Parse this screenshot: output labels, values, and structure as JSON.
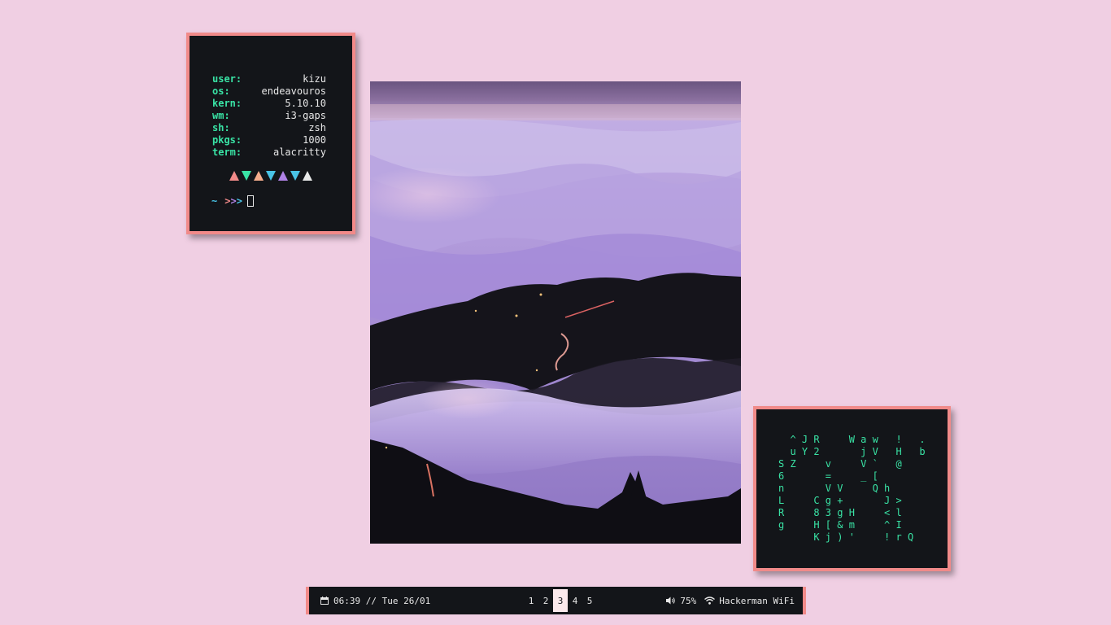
{
  "fetch": {
    "rows": [
      {
        "key": "user:",
        "value": "kizu"
      },
      {
        "key": "os:",
        "value": "endeavouros"
      },
      {
        "key": "kern:",
        "value": "5.10.10"
      },
      {
        "key": "wm:",
        "value": "i3-gaps"
      },
      {
        "key": "sh:",
        "value": "zsh"
      },
      {
        "key": "pkgs:",
        "value": "1000"
      },
      {
        "key": "term:",
        "value": "alacritty"
      }
    ],
    "triangle_colors": [
      "#f18a89",
      "#39e3a5",
      "#f4ad8c",
      "#49c3e6",
      "#b082e6",
      "#49c3e6",
      "#e8e8e8"
    ],
    "prompt": {
      "tilde": "~",
      "a1": ">",
      "a2": ">",
      "a3": ">"
    }
  },
  "matrix": {
    "lines": [
      "  ^ J R     W a w   !   .",
      "  u Y 2       j V   H   b",
      "S Z     v     V `   @",
      "6       =     _ [",
      "n       V V     Q h",
      "L     C g +       J >",
      "R     8 3 g H     < l",
      "g     H [ & m     ^ I",
      "      K j ) '     ! r Q"
    ]
  },
  "bar": {
    "clock_icon": "calendar-icon",
    "clock": "06:39 // Tue 26/01",
    "workspaces": [
      "1",
      "2",
      "3",
      "4",
      "5"
    ],
    "active_workspace": "3",
    "volume_icon": "speaker-icon",
    "volume": "75%",
    "wifi_icon": "wifi-icon",
    "network": "Hackerman WiFi"
  },
  "colors": {
    "background": "#f0cfe3",
    "window_bg": "#131519",
    "border": "#f18a89",
    "green": "#39e3a5",
    "cyan": "#49c3e6",
    "purple": "#b082e6"
  }
}
